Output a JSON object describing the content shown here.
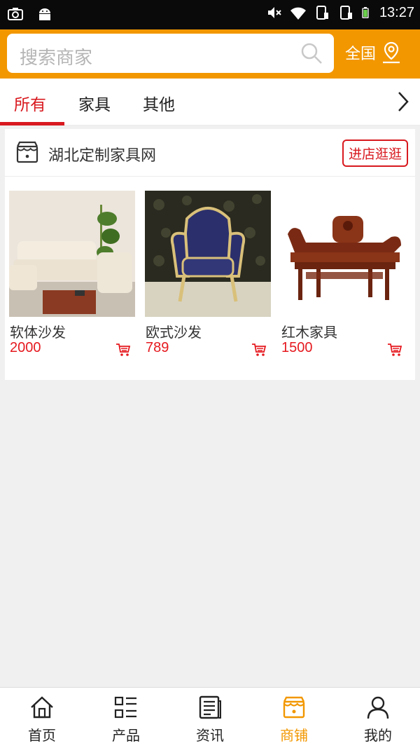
{
  "status_bar": {
    "time": "13:27"
  },
  "header": {
    "search_placeholder": "搜索商家",
    "region_label": "全国"
  },
  "tabs": [
    {
      "label": "所有",
      "active": true
    },
    {
      "label": "家具",
      "active": false
    },
    {
      "label": "其他",
      "active": false
    }
  ],
  "shop": {
    "name": "湖北定制家具网",
    "enter_label": "进店逛逛",
    "products": [
      {
        "name": "软体沙发",
        "price": "2000"
      },
      {
        "name": "欧式沙发",
        "price": "789"
      },
      {
        "name": "红木家具",
        "price": "1500"
      }
    ]
  },
  "bottom_nav": [
    {
      "label": "首页",
      "icon": "home-icon",
      "active": false
    },
    {
      "label": "产品",
      "icon": "list-icon",
      "active": false
    },
    {
      "label": "资讯",
      "icon": "news-icon",
      "active": false
    },
    {
      "label": "商铺",
      "icon": "store-icon",
      "active": true
    },
    {
      "label": "我的",
      "icon": "user-icon",
      "active": false
    }
  ],
  "colors": {
    "accent": "#f29700",
    "price": "#e5191f",
    "tab_active": "#d8191f"
  }
}
